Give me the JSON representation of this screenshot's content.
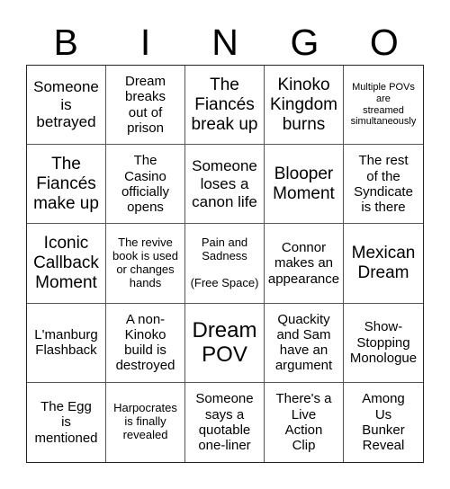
{
  "header": {
    "letters": [
      "B",
      "I",
      "N",
      "G",
      "O"
    ]
  },
  "cells": [
    {
      "text": "Someone\nis\nbetrayed",
      "size": "lg"
    },
    {
      "text": "Dream\nbreaks\nout of\nprison",
      "size": "md"
    },
    {
      "text": "The\nFiancés\nbreak up",
      "size": "xl"
    },
    {
      "text": "Kinoko\nKingdom\nburns",
      "size": "xl"
    },
    {
      "text": "Multiple POVs\nare\nstreamed\nsimultaneously",
      "size": "xs"
    },
    {
      "text": "The\nFiancés\nmake up",
      "size": "xl"
    },
    {
      "text": "The\nCasino\nofficially\nopens",
      "size": "md"
    },
    {
      "text": "Someone\nloses a\ncanon life",
      "size": "lg"
    },
    {
      "text": "Blooper\nMoment",
      "size": "xl"
    },
    {
      "text": "The rest\nof the\nSyndicate\nis there",
      "size": "md"
    },
    {
      "text": "Iconic\nCallback\nMoment",
      "size": "xl"
    },
    {
      "text": "The revive\nbook is used\nor changes\nhands",
      "size": "sm"
    },
    {
      "text": "Pain and\nSadness\n\n(Free Space)",
      "size": "sm",
      "free": true
    },
    {
      "text": "Connor\nmakes an\nappearance",
      "size": "md"
    },
    {
      "text": "Mexican\nDream",
      "size": "xl"
    },
    {
      "text": "L'manburg\nFlashback",
      "size": "md"
    },
    {
      "text": "A non-\nKinoko\nbuild is\ndestroyed",
      "size": "md"
    },
    {
      "text": "Dream\nPOV",
      "size": "xxl"
    },
    {
      "text": "Quackity\nand Sam\nhave an\nargument",
      "size": "md"
    },
    {
      "text": "Show-\nStopping\nMonologue",
      "size": "md"
    },
    {
      "text": "The Egg\nis\nmentioned",
      "size": "md"
    },
    {
      "text": "Harpocrates\nis finally\nrevealed",
      "size": "sm"
    },
    {
      "text": "Someone\nsays a\nquotable\none-liner",
      "size": "md"
    },
    {
      "text": "There's a\nLive\nAction\nClip",
      "size": "md"
    },
    {
      "text": "Among\nUs\nBunker\nReveal",
      "size": "md"
    }
  ]
}
